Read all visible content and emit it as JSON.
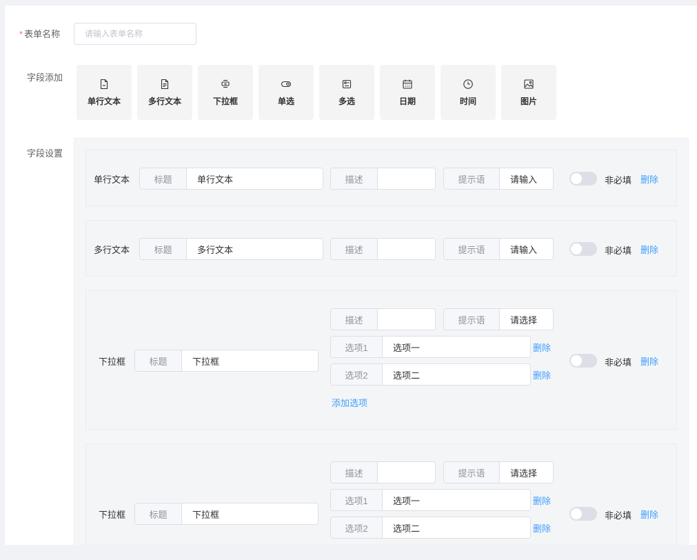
{
  "form": {
    "name_label": "表单名称",
    "required_star": "*",
    "name_placeholder": "请输入表单名称"
  },
  "add_fields": {
    "label": "字段添加",
    "types": [
      {
        "label": "单行文本",
        "icon": "file-minus-icon"
      },
      {
        "label": "多行文本",
        "icon": "file-text-icon"
      },
      {
        "label": "下拉框",
        "icon": "dropdown-icon"
      },
      {
        "label": "单选",
        "icon": "radio-icon"
      },
      {
        "label": "多选",
        "icon": "checkbox-icon"
      },
      {
        "label": "日期",
        "icon": "calendar-icon"
      },
      {
        "label": "时间",
        "icon": "clock-icon"
      },
      {
        "label": "图片",
        "icon": "image-icon"
      }
    ]
  },
  "settings": {
    "label": "字段设置",
    "title_prefix": "标题",
    "desc_prefix": "描述",
    "hint_prefix": "提示语",
    "required_text": "非必填",
    "delete_text": "删除",
    "add_option_text": "添加选项",
    "fields": [
      {
        "type": "单行文本",
        "title": "单行文本",
        "desc": "",
        "hint": "请输入",
        "required": false
      },
      {
        "type": "多行文本",
        "title": "多行文本",
        "desc": "",
        "hint": "请输入",
        "required": false
      },
      {
        "type": "下拉框",
        "title": "下拉框",
        "desc": "",
        "hint": "请选择",
        "required": false,
        "options": [
          {
            "label": "选项1",
            "value": "选项一"
          },
          {
            "label": "选项2",
            "value": "选项二"
          }
        ]
      },
      {
        "type": "下拉框",
        "title": "下拉框",
        "desc": "",
        "hint": "请选择",
        "required": false,
        "options": [
          {
            "label": "选项1",
            "value": "选项一"
          },
          {
            "label": "选项2",
            "value": "选项二"
          }
        ]
      }
    ]
  }
}
